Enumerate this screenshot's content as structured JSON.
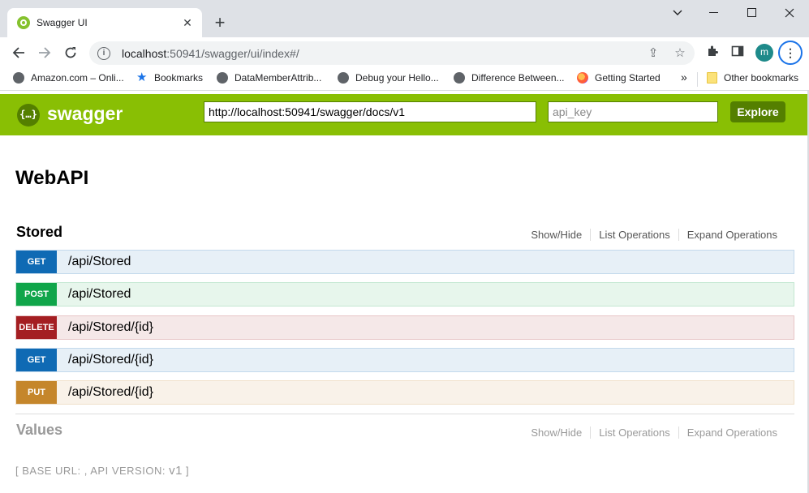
{
  "browser": {
    "tab_title": "Swagger UI",
    "url_host": "localhost",
    "url_rest": ":50941/swagger/ui/index#/",
    "avatar_letter": "m",
    "bookmarks": [
      {
        "label": "Amazon.com – Onli...",
        "icon": "globe-icon"
      },
      {
        "label": "Bookmarks",
        "icon": "star-icon"
      },
      {
        "label": "DataMemberAttrib...",
        "icon": "globe-icon"
      },
      {
        "label": "Debug your Hello...",
        "icon": "globe-icon"
      },
      {
        "label": "Difference Between...",
        "icon": "globe-icon"
      },
      {
        "label": "Getting Started",
        "icon": "firefox-icon"
      }
    ],
    "bookmarks_overflow": "»",
    "other_bookmarks": "Other bookmarks"
  },
  "swagger": {
    "logo_text": "swagger",
    "logo_icon_text": "{…}",
    "spec_url": "http://localhost:50941/swagger/docs/v1",
    "api_key_placeholder": "api_key",
    "explore_label": "Explore",
    "api_title": "WebAPI",
    "resources": [
      {
        "name": "Stored",
        "show_hide": "Show/Hide",
        "list_ops": "List Operations",
        "expand_ops": "Expand Operations",
        "operations": [
          {
            "method": "GET",
            "path": "/api/Stored"
          },
          {
            "method": "POST",
            "path": "/api/Stored"
          },
          {
            "method": "DELETE",
            "path": "/api/Stored/{id}"
          },
          {
            "method": "GET",
            "path": "/api/Stored/{id}"
          },
          {
            "method": "PUT",
            "path": "/api/Stored/{id}"
          }
        ]
      },
      {
        "name": "Values",
        "show_hide": "Show/Hide",
        "list_ops": "List Operations",
        "expand_ops": "Expand Operations"
      }
    ],
    "footer": {
      "prefix": "[ BASE URL: , API VERSION: ",
      "version": "v1",
      "suffix": " ]"
    }
  },
  "colors": {
    "swagger_green": "#89bf04",
    "get": "#0f6ab4",
    "post": "#10a54a",
    "delete": "#a41e22",
    "put": "#c5862b"
  }
}
